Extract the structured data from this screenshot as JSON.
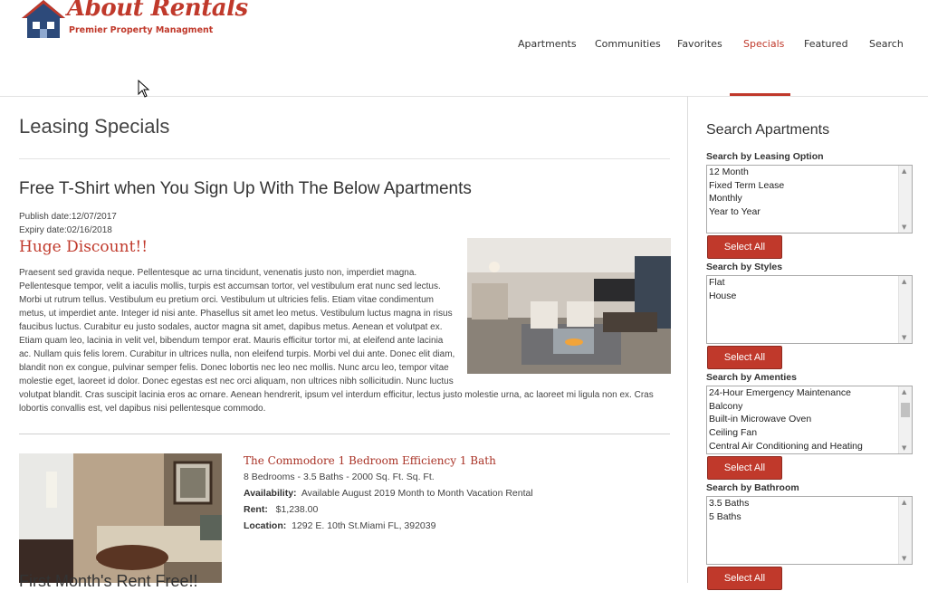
{
  "brand": {
    "name": "About Rentals",
    "tagline": "Premier Property Managment"
  },
  "nav": {
    "items": [
      {
        "label": "Apartments"
      },
      {
        "label": "Communities"
      },
      {
        "label": "Favorites"
      },
      {
        "label": "Specials",
        "active": true
      },
      {
        "label": "Featured"
      },
      {
        "label": "Search"
      }
    ],
    "accent_color": "#c0392b"
  },
  "main": {
    "page_title": "Leasing Specials",
    "special": {
      "title": "Free T-Shirt when You Sign Up With The Below Apartments",
      "publish_date": "Publish date:12/07/2017",
      "expiry_date": "Expiry date:02/16/2018",
      "headline": "Huge Discount!!",
      "body": "Praesent sed gravida neque. Pellentesque ac urna tincidunt, venenatis justo non, imperdiet magna. Pellentesque tempor, velit a iaculis mollis, turpis est accumsan tortor, vel vestibulum erat nunc sed lectus. Morbi ut rutrum tellus. Vestibulum eu pretium orci. Vestibulum ut ultricies felis. Etiam vitae condimentum metus, ut imperdiet ante. Integer id nisi ante. Phasellus sit amet leo metus. Vestibulum luctus magna in risus faucibus luctus. Curabitur eu justo sodales, auctor magna sit amet, dapibus metus. Aenean et volutpat ex. Etiam quam leo, lacinia in velit vel, bibendum tempor erat. Mauris efficitur tortor mi, at eleifend ante lacinia ac. Nullam quis felis lorem. Curabitur in ultrices nulla, non eleifend turpis. Morbi vel dui ante. Donec elit diam, blandit non ex congue, pulvinar semper felis. Donec lobortis nec leo nec mollis. Nunc arcu leo, tempor vitae molestie eget, laoreet id dolor. Donec egestas est nec orci aliquam, non ultrices nibh sollicitudin. Nunc luctus volutpat blandit. Cras suscipit lacinia eros ac ornare. Aenean hendrerit, ipsum vel interdum efficitur, lectus justo molestie urna, ac laoreet mi ligula non ex. Cras lobortis convallis est, vel dapibus nisi pellentesque commodo."
    },
    "listing": {
      "title": "The Commodore 1 Bedroom Efficiency 1 Bath",
      "summary": "8 Bedrooms - 3.5 Baths - 2000 Sq. Ft. Sq. Ft.",
      "availability_label": "Availability:",
      "availability": "Available August 2019 Month to Month Vacation Rental",
      "rent_label": "Rent:",
      "rent": "$1,238.00",
      "location_label": "Location:",
      "location": "1292 E. 10th St.Miami FL, 392039"
    },
    "next_special_title": "First Month's Rent Free!!"
  },
  "sidebar": {
    "title": "Search Apartments",
    "select_all_label": "Select All",
    "groups": [
      {
        "label": "Search by Leasing Option",
        "options": [
          "12 Month",
          "Fixed Term Lease",
          "Monthly",
          "Year to Year"
        ]
      },
      {
        "label": "Search by Styles",
        "options": [
          "Flat",
          "House"
        ]
      },
      {
        "label": "Search by Amenties",
        "options": [
          "24-Hour Emergency Maintenance",
          "Balcony",
          "Built-in Microwave Oven",
          "Ceiling Fan",
          "Central Air Conditioning and Heating"
        ]
      },
      {
        "label": "Search by Bathroom",
        "options": [
          "3.5 Baths",
          "5 Baths"
        ]
      }
    ]
  }
}
